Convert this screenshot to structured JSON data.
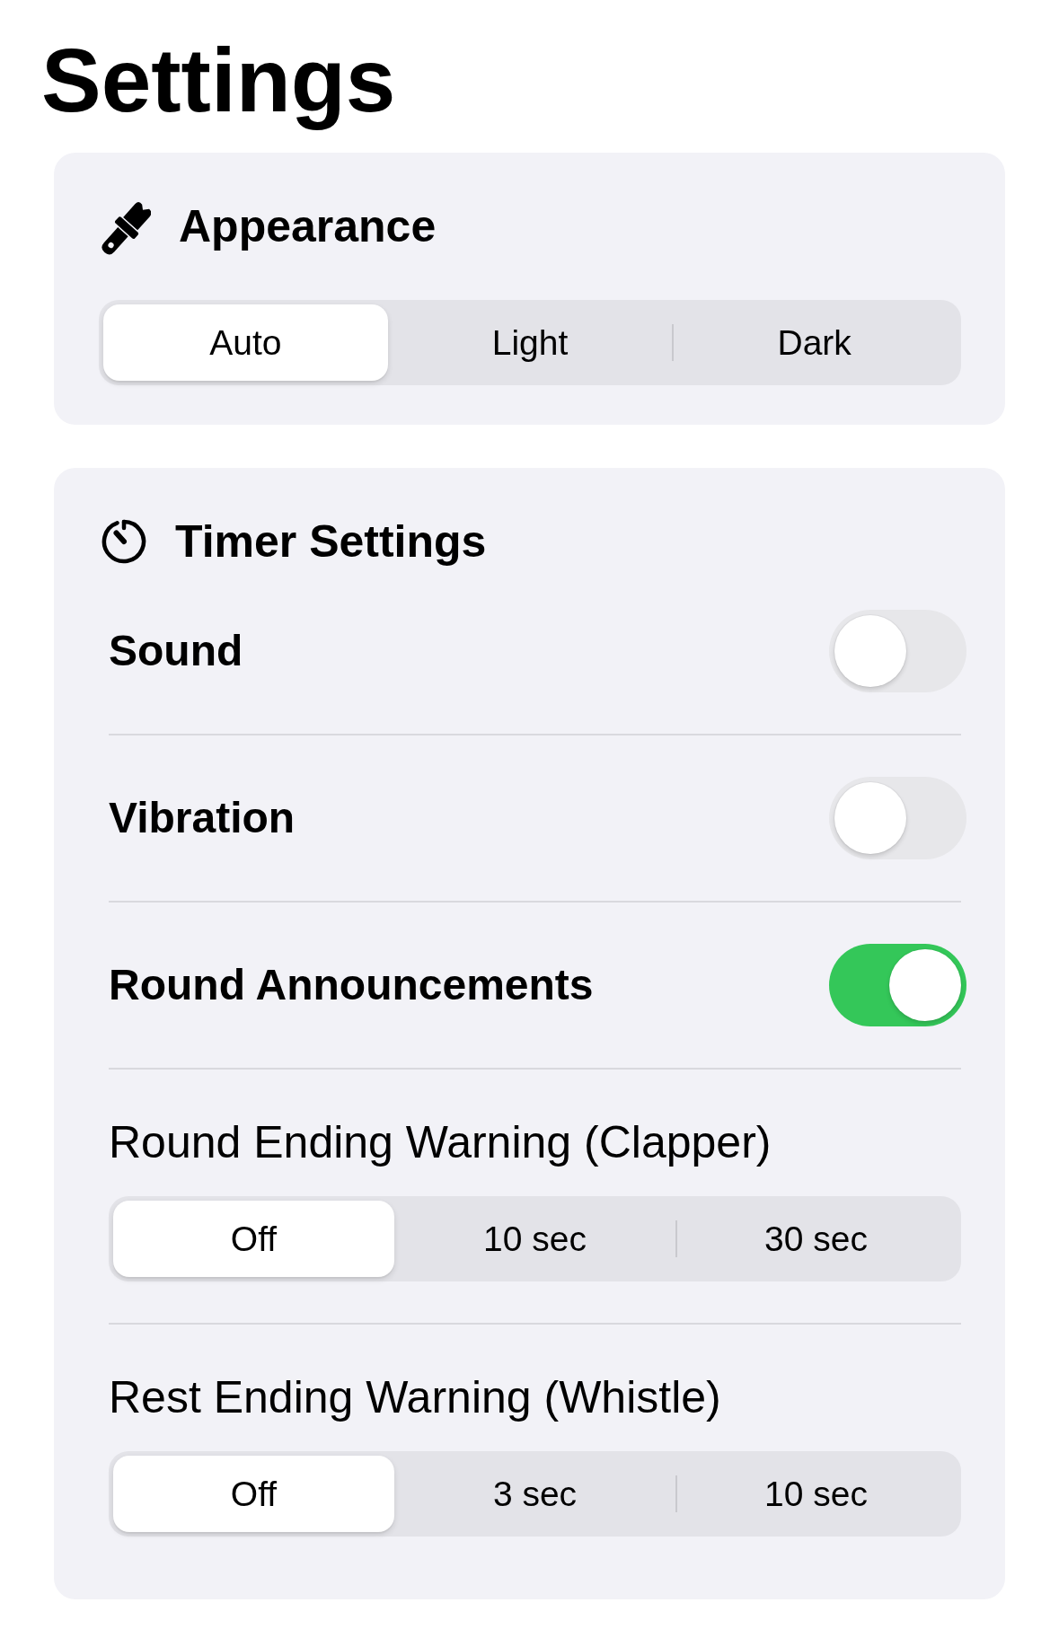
{
  "title": "Settings",
  "sections": [
    {
      "title": "Appearance",
      "rows": [
        {
          "kind": "segmented",
          "options": [
            {
              "label": "Auto",
              "selected": true
            },
            {
              "label": "Light",
              "selected": false
            },
            {
              "label": "Dark",
              "selected": false
            }
          ]
        }
      ]
    },
    {
      "title": "Timer Settings",
      "rows": [
        {
          "kind": "toggle",
          "label": "Sound",
          "on": false
        },
        {
          "kind": "toggle",
          "label": "Vibration",
          "on": false
        },
        {
          "kind": "toggle",
          "label": "Round Announcements",
          "on": true
        },
        {
          "kind": "segmented",
          "label": "Round Ending Warning (Clapper)",
          "options": [
            {
              "label": "Off",
              "selected": true
            },
            {
              "label": "10 sec",
              "selected": false
            },
            {
              "label": "30 sec",
              "selected": false
            }
          ]
        },
        {
          "kind": "segmented",
          "label": "Rest Ending Warning (Whistle)",
          "options": [
            {
              "label": "Off",
              "selected": true
            },
            {
              "label": "3 sec",
              "selected": false
            },
            {
              "label": "10 sec",
              "selected": false
            }
          ]
        }
      ]
    }
  ]
}
